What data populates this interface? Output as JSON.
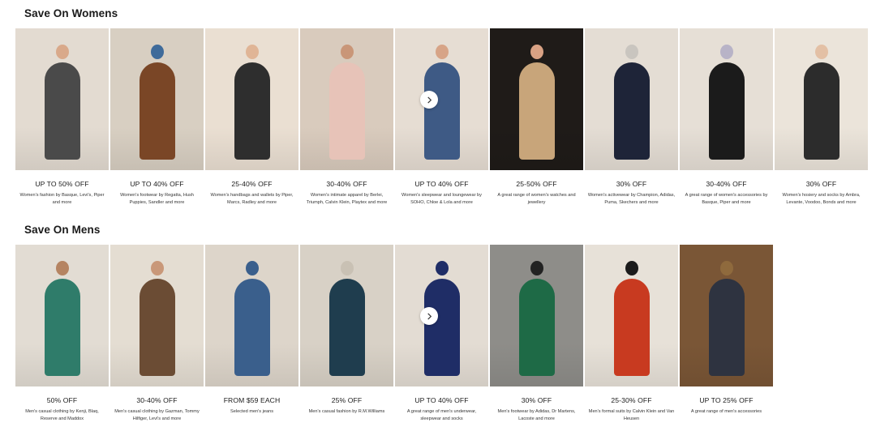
{
  "womens": {
    "title": "Save On Womens",
    "arrow_icon": "chevron-right-icon",
    "cards": [
      {
        "headline": "UP TO 50% OFF",
        "desc": "Women's fashion by Basque, Levi's, Piper and more",
        "bg": "#e3dbd1",
        "figure": "#4a4a4a",
        "skin": "#d9a98a"
      },
      {
        "headline": "UP TO 40% OFF",
        "desc": "Women's footwear by Regatta, Hush Puppies, Sandler and more",
        "bg": "#d8cfc2",
        "figure": "#7a4626",
        "skin": "#3f6b9a"
      },
      {
        "headline": "25-40% OFF",
        "desc": "Women's handbags and wallets by Piper, Marcs, Radley and more",
        "bg": "#eadfd2",
        "figure": "#2e2e2e",
        "skin": "#e0b596"
      },
      {
        "headline": "30-40% OFF",
        "desc": "Women's intimate apparel by Berlei, Triumph, Calvin Klein, Playtex and more",
        "bg": "#d9cbbd",
        "figure": "#e7c3b8",
        "skin": "#c99678"
      },
      {
        "headline": "UP TO 40% OFF",
        "desc": "Women's sleepwear and loungewear by SOHO, Chloe & Lola and more",
        "bg": "#e6ddd3",
        "figure": "#3e5a85",
        "skin": "#d7a487"
      },
      {
        "headline": "25-50% OFF",
        "desc": "A great range of women's watches and jewellery",
        "bg": "#1f1b18",
        "figure": "#c8a57a",
        "skin": "#d9a284"
      },
      {
        "headline": "30% OFF",
        "desc": "Women's activewear by Champion, Adidas, Puma, Skechers and more",
        "bg": "#e4ddd4",
        "figure": "#1e2438",
        "skin": "#c9c5bf"
      },
      {
        "headline": "30-40% OFF",
        "desc": "A great range of women's accessories by Basque, Piper and more",
        "bg": "#e6dfd6",
        "figure": "#1b1b1b",
        "skin": "#b8b3c7"
      },
      {
        "headline": "30% OFF",
        "desc": "Women's hosiery and socks by Ambra, Levante, Voodoo, Bonds and more",
        "bg": "#ebe4da",
        "figure": "#2c2c2c",
        "skin": "#e3c0a5"
      }
    ]
  },
  "mens": {
    "title": "Save On Mens",
    "arrow_icon": "chevron-right-icon",
    "cards": [
      {
        "headline": "50% OFF",
        "desc": "Men's casual clothing by Kenji, Blaq, Reserve and Maddox",
        "bg": "#e2dcd3",
        "figure": "#2f7c6a",
        "skin": "#b58462"
      },
      {
        "headline": "30-40% OFF",
        "desc": "Men's casual clothing by Gazman, Tommy Hilfiger, Levi's and more",
        "bg": "#e4ddd2",
        "figure": "#6b4c34",
        "skin": "#c99879"
      },
      {
        "headline": "FROM $59 EACH",
        "desc": "Selected men's jeans",
        "bg": "#ddd5ca",
        "figure": "#3a5f8c",
        "skin": "#3a5f8c"
      },
      {
        "headline": "25% OFF",
        "desc": "Men's casual fashion by R.M.Williams",
        "bg": "#d8d1c6",
        "figure": "#1f3d4e",
        "skin": "#c9c1b4"
      },
      {
        "headline": "UP TO 40% OFF",
        "desc": "A great range of men's underwear, sleepwear and socks",
        "bg": "#e3dcd3",
        "figure": "#1f2d66",
        "skin": "#1f2d66"
      },
      {
        "headline": "30% OFF",
        "desc": "Men's footwear by Adidas, Dr Martens, Lacoste and more",
        "bg": "#8e8d89",
        "figure": "#1e6a46",
        "skin": "#222222"
      },
      {
        "headline": "25-30% OFF",
        "desc": "Men's formal suits by Calvin Klein and Van Heusen",
        "bg": "#e7e1d8",
        "figure": "#c83a20",
        "skin": "#1b1b1b"
      },
      {
        "headline": "UP TO 25% OFF",
        "desc": "A great range of men's accessories",
        "bg": "#7a5636",
        "figure": "#2e3340",
        "skin": "#8f6a3d"
      }
    ]
  }
}
